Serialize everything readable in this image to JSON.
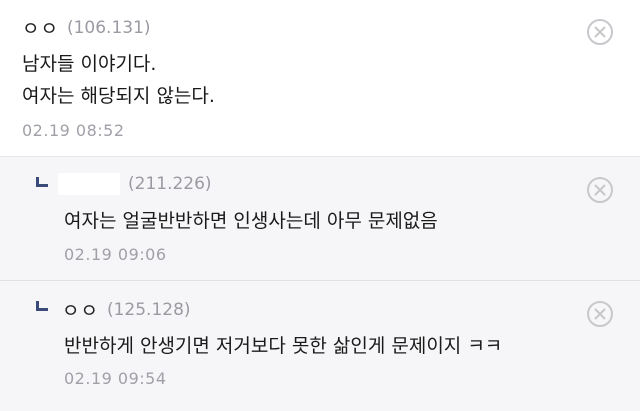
{
  "comments": [
    {
      "nick": "ㅇㅇ",
      "ip": "(106.131)",
      "lines": [
        "남자들 이야기다.",
        "여자는 해당되지 않는다."
      ],
      "date": "02.19 08:52"
    },
    {
      "nick": "",
      "ip": "(211.226)",
      "text": "여자는 얼굴반반하면 인생사는데 아무 문제없음",
      "date": "02.19 09:06"
    },
    {
      "nick": "ㅇㅇ",
      "ip": "(125.128)",
      "text": "반반하게 안생기면 저거보다 못한 삶인게 문제이지 ㅋㅋ",
      "date": "02.19 09:54"
    }
  ],
  "colors": {
    "reply_arrow": "#3a4b7a",
    "reply_bg": "#f6f6f8",
    "ip_text": "#9a9aa2"
  },
  "icons": {
    "delete": "close-circle-icon",
    "reply": "reply-arrow-icon"
  }
}
